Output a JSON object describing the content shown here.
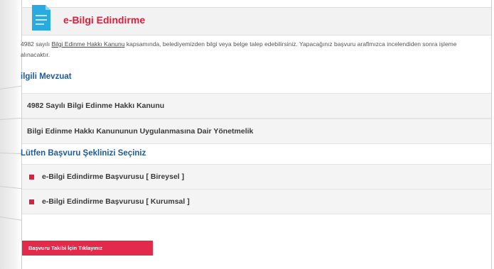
{
  "header": {
    "title": "e-Bilgi Edindirme",
    "icon": "document-icon"
  },
  "intro": {
    "text_before_link": "4982 sayılı ",
    "link_text": "Bilgi Edinme Hakkı Kanunu",
    "text_after_link": " kapsamında, belediyemizden bilgi veya belge talep edebilirsiniz. Yapacağınız başvuru araflmızca incelendiden sonra işleme alınacaktır."
  },
  "legislation": {
    "heading": "ilgili Mevzuat",
    "items": [
      {
        "label": "4982 Sayılı Bilgi Edinme Hakkı Kanunu"
      },
      {
        "label": "Bilgi Edinme Hakkı Kanununun Uygulanmasına Dair Yönetmelik"
      }
    ]
  },
  "application": {
    "heading": "Lütfen Başvuru Şeklinizi Seçiniz",
    "options": [
      {
        "label": "e-Bilgi Edindirme Başvurusu [ Bireysel ]"
      },
      {
        "label": "e-Bilgi Edindirme Başvurusu [ Kurumsal ]"
      }
    ]
  },
  "track_button": {
    "label": "Başvuru Takibi İçin Tıklayınız"
  },
  "colors": {
    "accent": "#d8213e",
    "button": "#e32a4b",
    "heading": "#1f5b9e",
    "icon": "#29abe2"
  }
}
